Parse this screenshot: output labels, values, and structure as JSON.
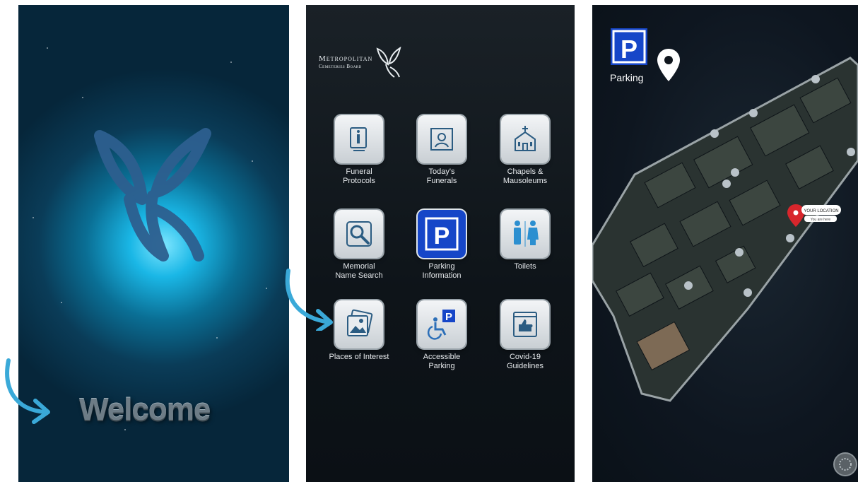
{
  "screen1": {
    "welcome_text": "Welcome"
  },
  "screen2": {
    "brand_line1": "Metropolitan",
    "brand_line2": "Cemeteries Board",
    "tiles": [
      {
        "label": "Funeral\nProtocols",
        "icon": "info-stand-icon"
      },
      {
        "label": "Today's\nFunerals",
        "icon": "person-frame-icon"
      },
      {
        "label": "Chapels &\nMausoleums",
        "icon": "chapel-icon"
      },
      {
        "label": "Memorial\nName Search",
        "icon": "magnifier-icon"
      },
      {
        "label": "Parking\nInformation",
        "icon": "parking-icon"
      },
      {
        "label": "Toilets",
        "icon": "toilet-icon"
      },
      {
        "label": "Places of Interest",
        "icon": "photos-icon"
      },
      {
        "label": "Accessible\nParking",
        "icon": "accessible-parking-icon"
      },
      {
        "label": "Covid-19\nGuidelines",
        "icon": "guidelines-icon"
      }
    ]
  },
  "screen3": {
    "title": "Parking",
    "your_location_label": "YOUR LOCATION",
    "you_are_here": "You are here"
  },
  "colors": {
    "accent_arrow": "#3aa9d8",
    "parking_blue": "#1646c8",
    "location_red": "#d8262c"
  }
}
